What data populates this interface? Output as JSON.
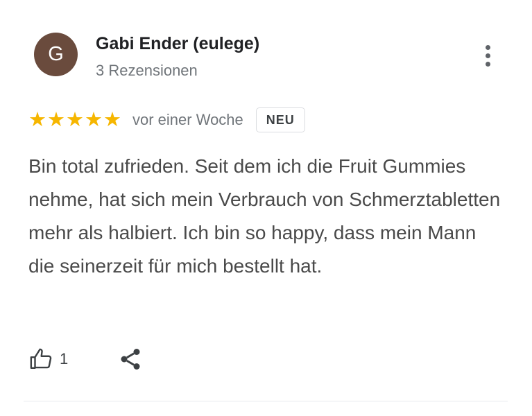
{
  "author": {
    "initial": "G",
    "name": "Gabi Ender (eulege)",
    "review_count": "3 Rezensionen",
    "avatar_color": "#6a4b3d"
  },
  "rating": {
    "stars": 5,
    "max": 5,
    "star_glyph": "★",
    "star_color": "#f6b600"
  },
  "date": "vor einer Woche",
  "badge": "NEU",
  "review_text": "Bin total zufrieden. Seit dem ich die Fruit Gummies nehme, hat sich mein Verbrauch von Schmerztabletten mehr als halbiert. Ich bin so happy, dass mein Mann die seinerzeit für mich bestellt hat.",
  "actions": {
    "like_icon": "thumbs-up-icon",
    "like_count": "1",
    "share_icon": "share-icon",
    "more_icon": "more-vert-icon"
  }
}
